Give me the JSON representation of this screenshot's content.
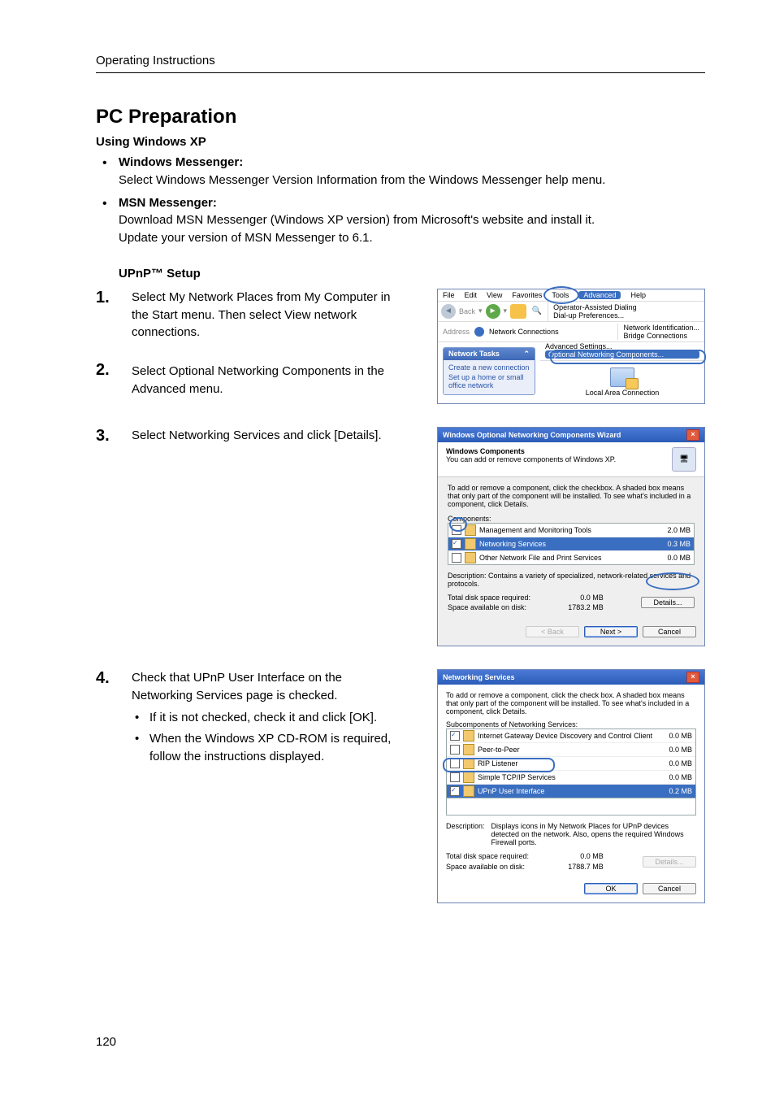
{
  "header": {
    "running_head": "Operating Instructions"
  },
  "page_number": "120",
  "section": {
    "title": "PC Preparation",
    "using": "Using Windows XP",
    "bullets": [
      {
        "head": "Windows Messenger:",
        "body": "Select Windows Messenger Version Information from the Windows Messenger help menu."
      },
      {
        "head": "MSN Messenger:",
        "body1": "Download MSN Messenger (Windows XP version) from Microsoft's website and install it.",
        "body2": "Update your version of MSN Messenger to 6.1."
      }
    ],
    "upnp_head": "UPnP™ Setup"
  },
  "steps": {
    "s1": "Select My Network Places from My Computer in the Start menu. Then select View network connections.",
    "s2": "Select Optional Networking Components in the Advanced menu.",
    "s3": "Select Networking Services and click [Details].",
    "s4a": "Check that UPnP User Interface on the Networking Services page is checked.",
    "s4b1": "If it is not checked, check it and click [OK].",
    "s4b2": "When the Windows XP CD-ROM is required, follow the instructions displayed."
  },
  "shot1": {
    "menus": {
      "file": "File",
      "edit": "Edit",
      "view": "View",
      "fav": "Favorites",
      "tools": "Tools",
      "adv": "Advanced",
      "help": "Help"
    },
    "toolbar_back": "Back",
    "adv_menu": {
      "a": "Operator-Assisted Dialing",
      "b": "Dial-up Preferences...",
      "c": "Network Identification...",
      "d": "Bridge Connections",
      "e": "Advanced Settings...",
      "f": "Optional Networking Components..."
    },
    "address_lbl": "Address",
    "address_val": "Network Connections",
    "panel_title": "Network Tasks",
    "panel_a": "Create a new connection",
    "panel_b": "Set up a home or small office network",
    "conn": "Local Area Connection"
  },
  "shot2": {
    "title": "Windows Optional Networking Components Wizard",
    "head": "Windows Components",
    "sub": "You can add or remove components of Windows XP.",
    "intro": "To add or remove a component, click the checkbox. A shaded box means that only part of the component will be installed. To see what's included in a component, click Details.",
    "comp_lbl": "Components:",
    "rows": [
      {
        "name": "Management and Monitoring Tools",
        "size": "2.0 MB",
        "checked": false,
        "sel": false
      },
      {
        "name": "Networking Services",
        "size": "0.3 MB",
        "checked": true,
        "sel": true
      },
      {
        "name": "Other Network File and Print Services",
        "size": "0.0 MB",
        "checked": false,
        "sel": false
      }
    ],
    "desc_lbl": "Description:",
    "desc": "Contains a variety of specialized, network-related services and protocols.",
    "req_lbl": "Total disk space required:",
    "req_val": "0.0 MB",
    "avail_lbl": "Space available on disk:",
    "avail_val": "1783.2 MB",
    "btn_details": "Details...",
    "btn_back": "< Back",
    "btn_next": "Next >",
    "btn_cancel": "Cancel"
  },
  "shot3": {
    "title": "Networking Services",
    "intro": "To add or remove a component, click the check box. A shaded box means that only part of the component will be installed. To see what's included in a component, click Details.",
    "sub_lbl": "Subcomponents of Networking Services:",
    "rows": [
      {
        "name": "Internet Gateway Device Discovery and Control Client",
        "size": "0.0 MB",
        "checked": true,
        "sel": false
      },
      {
        "name": "Peer-to-Peer",
        "size": "0.0 MB",
        "checked": false,
        "sel": false
      },
      {
        "name": "RIP Listener",
        "size": "0.0 MB",
        "checked": false,
        "sel": false
      },
      {
        "name": "Simple TCP/IP Services",
        "size": "0.0 MB",
        "checked": false,
        "sel": false
      },
      {
        "name": "UPnP User Interface",
        "size": "0.2 MB",
        "checked": true,
        "sel": true
      }
    ],
    "desc_lbl": "Description:",
    "desc": "Displays icons in My Network Places for UPnP devices detected on the network. Also, opens the required Windows Firewall ports.",
    "req_lbl": "Total disk space required:",
    "req_val": "0.0 MB",
    "avail_lbl": "Space available on disk:",
    "avail_val": "1788.7 MB",
    "btn_details": "Details...",
    "btn_ok": "OK",
    "btn_cancel": "Cancel"
  }
}
